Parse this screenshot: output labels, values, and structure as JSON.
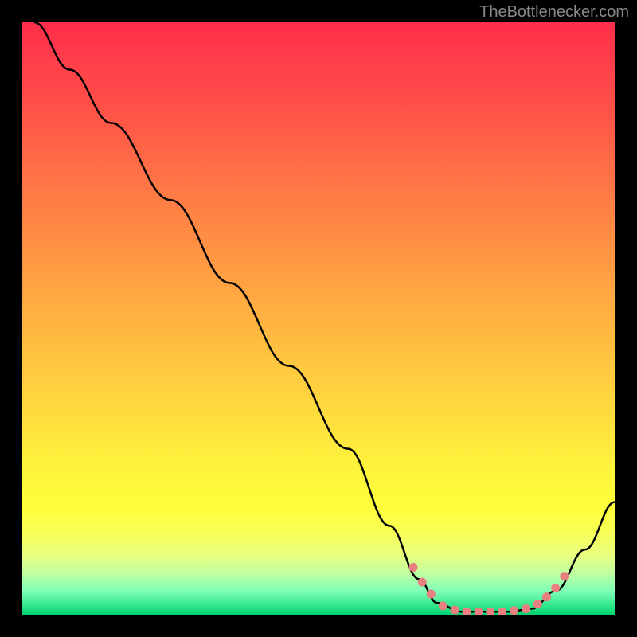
{
  "attribution": "TheBottlenecker.com",
  "chart_data": {
    "type": "line",
    "title": "",
    "xlabel": "",
    "ylabel": "",
    "x_range": [
      0,
      100
    ],
    "y_range": [
      0,
      100
    ],
    "background_gradient": {
      "description": "Vertical gradient from red (top) to green (bottom) indicating bottleneck severity",
      "stops": [
        {
          "pos": 0,
          "color": "#ff2e4a",
          "meaning": "high bottleneck"
        },
        {
          "pos": 50,
          "color": "#ffbf40",
          "meaning": "moderate"
        },
        {
          "pos": 85,
          "color": "#feff3a",
          "meaning": "low"
        },
        {
          "pos": 100,
          "color": "#00d070",
          "meaning": "optimal"
        }
      ]
    },
    "series": [
      {
        "name": "bottleneck-curve",
        "color": "#000000",
        "points": [
          {
            "x": 2,
            "y": 100
          },
          {
            "x": 8,
            "y": 92
          },
          {
            "x": 15,
            "y": 83
          },
          {
            "x": 25,
            "y": 70
          },
          {
            "x": 35,
            "y": 56
          },
          {
            "x": 45,
            "y": 42
          },
          {
            "x": 55,
            "y": 28
          },
          {
            "x": 62,
            "y": 15
          },
          {
            "x": 67,
            "y": 6
          },
          {
            "x": 70,
            "y": 2
          },
          {
            "x": 74,
            "y": 0.5
          },
          {
            "x": 78,
            "y": 0.5
          },
          {
            "x": 82,
            "y": 0.5
          },
          {
            "x": 86,
            "y": 1
          },
          {
            "x": 90,
            "y": 4
          },
          {
            "x": 95,
            "y": 11
          },
          {
            "x": 100,
            "y": 19
          }
        ]
      },
      {
        "name": "highlight-markers",
        "color": "#e88080",
        "type": "scatter",
        "points": [
          {
            "x": 66,
            "y": 8
          },
          {
            "x": 67.5,
            "y": 5.5
          },
          {
            "x": 69,
            "y": 3.5
          },
          {
            "x": 71,
            "y": 1.5
          },
          {
            "x": 73,
            "y": 0.8
          },
          {
            "x": 75,
            "y": 0.5
          },
          {
            "x": 77,
            "y": 0.5
          },
          {
            "x": 79,
            "y": 0.5
          },
          {
            "x": 81,
            "y": 0.5
          },
          {
            "x": 83,
            "y": 0.7
          },
          {
            "x": 85,
            "y": 1
          },
          {
            "x": 87,
            "y": 1.8
          },
          {
            "x": 88.5,
            "y": 3
          },
          {
            "x": 90,
            "y": 4.5
          },
          {
            "x": 91.5,
            "y": 6.5
          }
        ]
      }
    ]
  }
}
